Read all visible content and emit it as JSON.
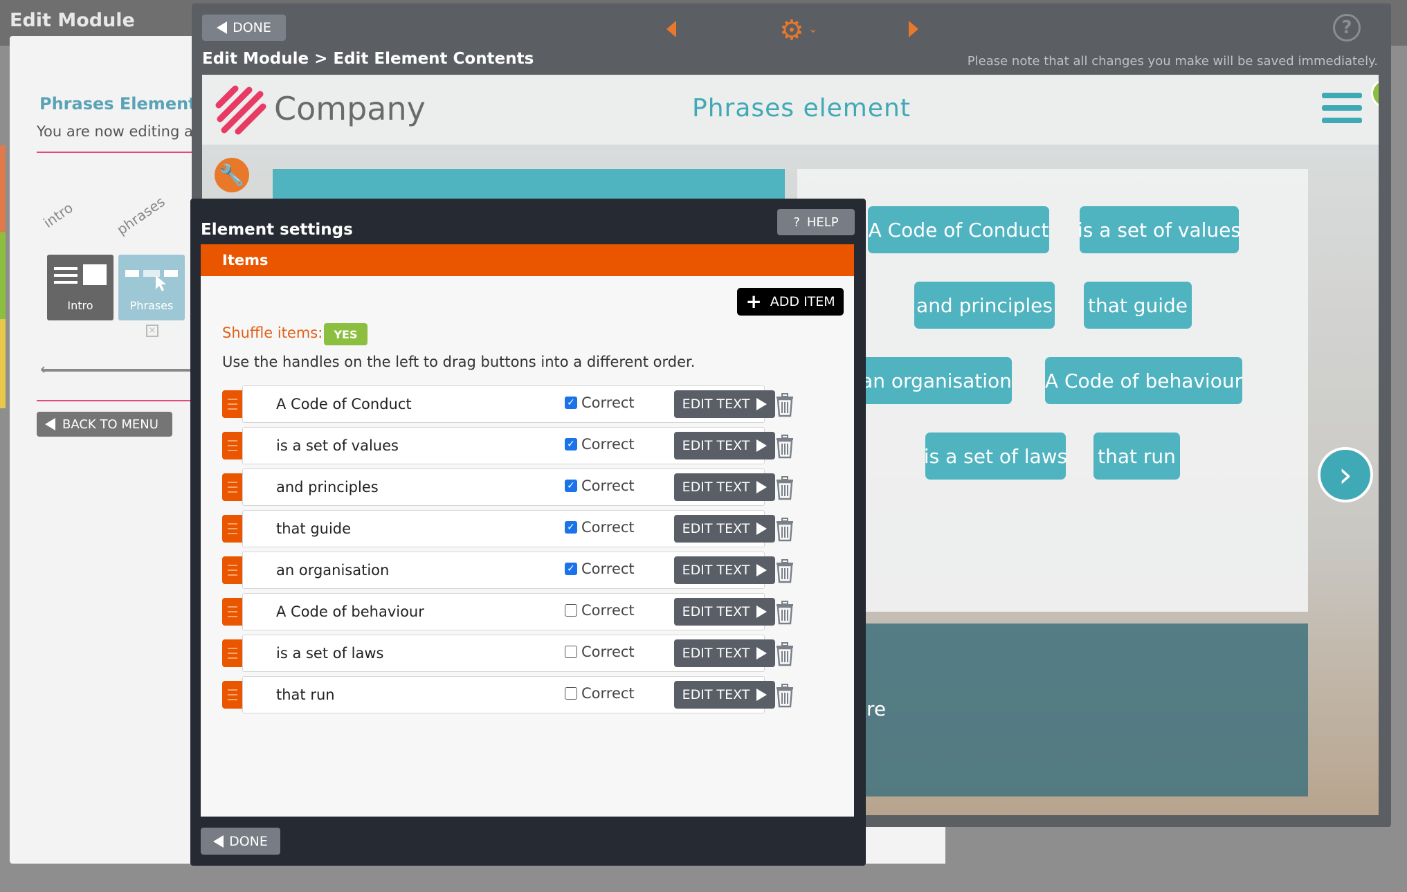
{
  "background": {
    "title": "Edit Module",
    "element_title": "Phrases Element",
    "editing_text": "You are now editing a c",
    "tabs": [
      "intro",
      "phrases"
    ],
    "tiles": [
      "Intro",
      "Phrases"
    ],
    "back_to_menu": "BACK TO MENU"
  },
  "editor": {
    "done_label": "DONE",
    "breadcrumb": "Edit Module > Edit Element Contents",
    "save_note": "Please note that all changes you make will be saved immediately.",
    "help_icon": "?"
  },
  "preview": {
    "company": "Company",
    "title": "Phrases element",
    "chips": [
      "A Code of Conduct",
      "is a set of values",
      "and principles",
      "that guide",
      "an organisation",
      "A Code of behaviour",
      "is a set of laws",
      "that run"
    ],
    "partial_text": "re"
  },
  "dialog": {
    "title": "Element settings",
    "help_label": "HELP",
    "help_icon": "?",
    "section_label": "Items",
    "add_item_label": "ADD ITEM",
    "shuffle_label": "Shuffle items:",
    "shuffle_value": "YES",
    "instructions": "Use the handles on the left to drag buttons into a different order.",
    "correct_label": "Correct",
    "edit_text_label": "EDIT TEXT",
    "items": [
      {
        "text": "A Code of Conduct",
        "correct": true
      },
      {
        "text": "is a set of values",
        "correct": true
      },
      {
        "text": "and principles",
        "correct": true
      },
      {
        "text": "that guide",
        "correct": true
      },
      {
        "text": "an organisation",
        "correct": true
      },
      {
        "text": "A Code of behaviour",
        "correct": false
      },
      {
        "text": "is a set of laws",
        "correct": false
      },
      {
        "text": "that run",
        "correct": false
      }
    ],
    "done_label": "DONE"
  },
  "colors": {
    "accent_orange": "#ea5600",
    "teal": "#4fb3c0",
    "toggle_green": "#8cbf3f",
    "dialog_bg": "#262b33"
  }
}
